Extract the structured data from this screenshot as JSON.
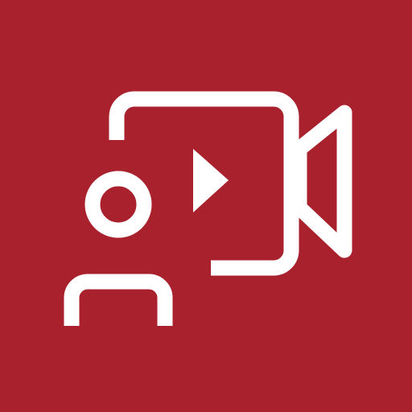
{
  "colors": {
    "background": "#a8212c",
    "foreground": "#ffffff"
  },
  "icons": {
    "main": "video-camera-with-person-icon",
    "parts": [
      "video-camera-body-icon",
      "camera-lens-icon",
      "play-icon",
      "person-head-icon",
      "person-body-icon"
    ]
  }
}
